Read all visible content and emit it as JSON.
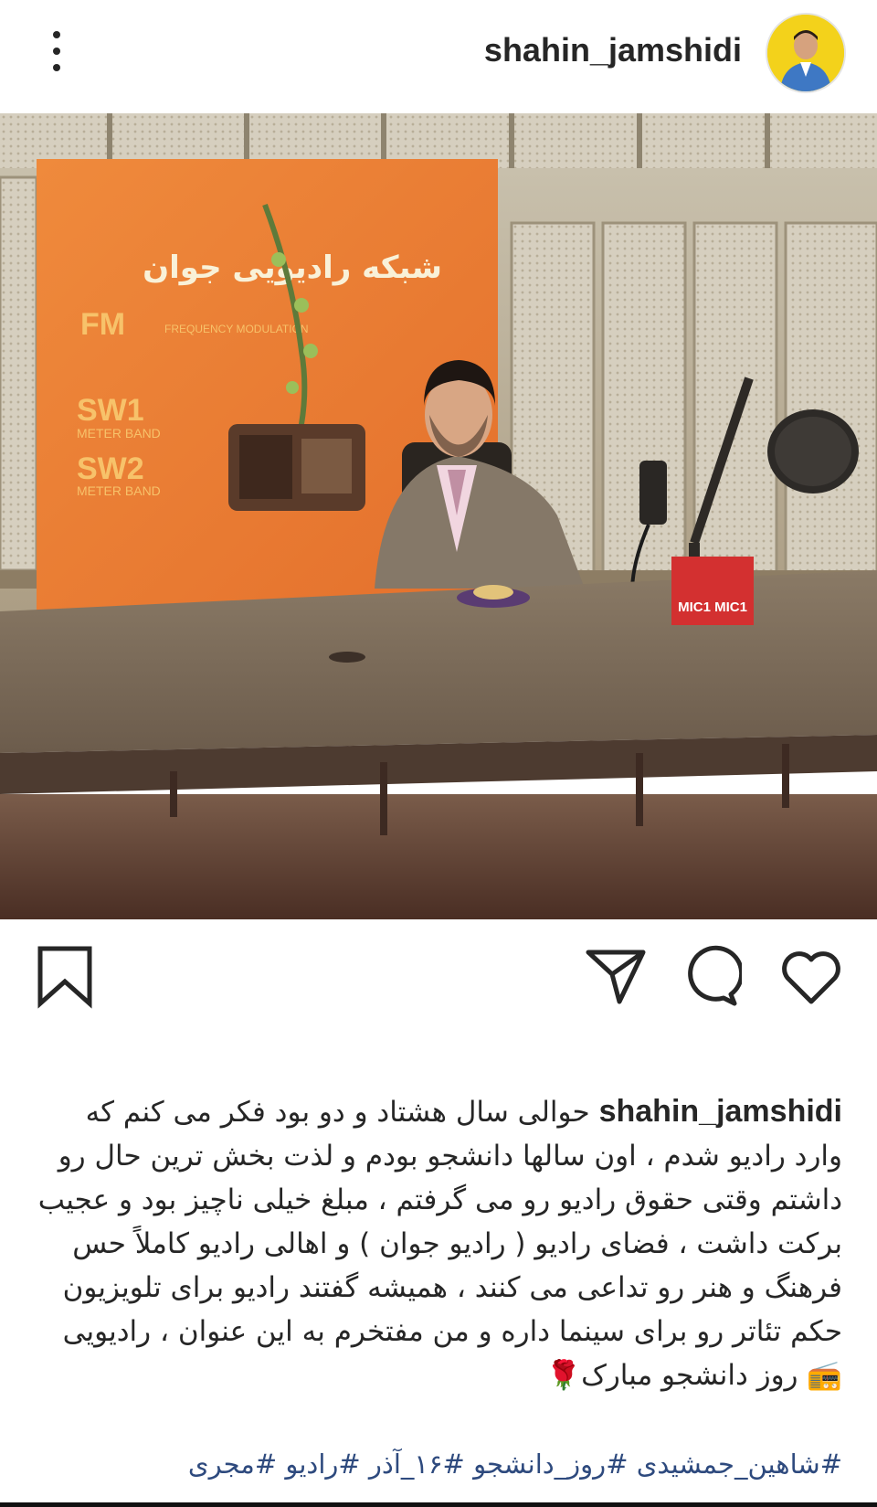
{
  "header": {
    "username": "shahin_jamshidi",
    "more_icon": "more-vertical-icon"
  },
  "photo": {
    "banner_title": "شبکه رادیویی جوان",
    "band_labels": [
      "FM",
      "SW1",
      "SW2"
    ],
    "band_sub": [
      "FREQUENCY MODULATION",
      "METER BAND",
      "METER BAND"
    ],
    "mic_label": "MIC1 MIC1"
  },
  "actions": {
    "like_icon": "heart-icon",
    "comment_icon": "comment-icon",
    "share_icon": "send-icon",
    "save_icon": "bookmark-icon"
  },
  "caption": {
    "username": "shahin_jamshidi",
    "text": "حوالی سال هشتاد و دو بود فکر می کنم که وارد رادیو شدم ، اون سالها دانشجو بودم و لذت بخش ترین حال رو داشتم وقتی حقوق رادیو رو می گرفتم ، مبلغ خیلی ناچیز بود و عجیب برکت داشت ، فضای رادیو ( رادیو جوان ) و اهالی رادیو کاملاً حس فرهنگ و هنر رو تداعی می کنند ، همیشه گفتند رادیو برای تلویزیون حکم تئاتر رو برای سینما داره و من مفتخرم به این عنوان ، رادیویی 📻 روز دانشجو مبارک🌹"
  },
  "hashtags": "#شاهین_جمشیدی #روز_دانشجو #۱۶_آذر #رادیو #مجری",
  "colors": {
    "text": "#262626",
    "hashtag": "#2e4a7e",
    "banner": "#e8843a"
  }
}
